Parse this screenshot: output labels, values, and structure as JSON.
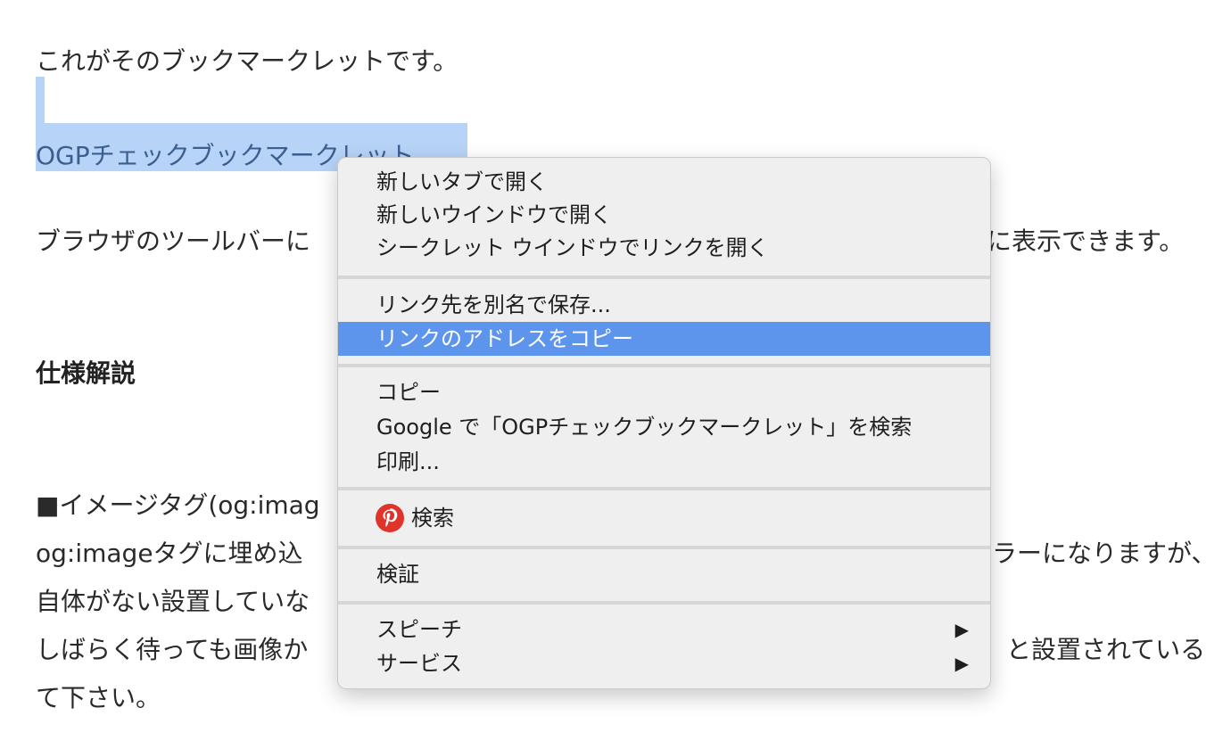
{
  "article": {
    "line1": "これがそのブックマークレットです。",
    "link": "OGPチェックブックマークレット",
    "line3_left": "ブラウザのツールバーに",
    "line3_right": "に表示できます。",
    "heading": "仕様解説",
    "line5_left": "■イメージタグ(og:imag",
    "line6_left": "og:imageタグに埋め込",
    "line6_right": "ラーになりますが、",
    "line7_left": "自体がない設置していな",
    "line8_left": "しばらく待っても画像か",
    "line8_right": "と設置されている",
    "line9_left": "て下さい。"
  },
  "context_menu": {
    "items": [
      {
        "label": "新しいタブで開く"
      },
      {
        "label": "新しいウインドウで開く"
      },
      {
        "label": "シークレット ウインドウでリンクを開く"
      },
      {
        "label": "リンク先を別名で保存..."
      },
      {
        "label": "リンクのアドレスをコピー"
      },
      {
        "label": "コピー"
      },
      {
        "label": "Google で「OGPチェックブックマークレット」を検索"
      },
      {
        "label": "印刷..."
      },
      {
        "label": "検索",
        "icon": "pinterest-icon"
      },
      {
        "label": "検証"
      },
      {
        "label": "スピーチ",
        "submenu_arrow": "▶"
      },
      {
        "label": "サービス",
        "submenu_arrow": "▶"
      }
    ],
    "highlight_color": "#5d94ec",
    "pinterest_color": "#e0342b"
  }
}
